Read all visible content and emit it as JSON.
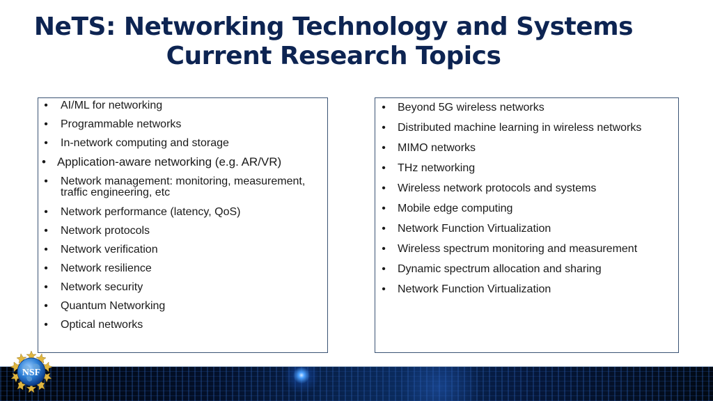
{
  "slide": {
    "title_line1": "NeTS: Networking Technology and Systems",
    "title_line2": "Current Research Topics"
  },
  "left_box": {
    "items": [
      "AI/ML for networking",
      "Programmable networks",
      "In-network computing and storage",
      "Application-aware networking (e.g.  AR/VR)",
      "Network management: monitoring, measurement, traffic engineering, etc",
      "Network performance (latency, QoS)",
      "Network protocols",
      "Network verification",
      "Network resilience",
      "Network security",
      "Quantum Networking",
      "Optical networks"
    ]
  },
  "right_box": {
    "items": [
      "Beyond 5G wireless networks",
      "Distributed machine learning in wireless networks",
      "MIMO networks",
      "THz networking",
      "Wireless network protocols and systems",
      "Mobile edge computing",
      "Network Function Virtualization",
      "Wireless spectrum monitoring and measurement",
      "Dynamic spectrum allocation and sharing",
      "Network Function Virtualization"
    ]
  },
  "bullet_char": "•",
  "logo": {
    "text": "NSF",
    "icon": "nsf-logo-icon"
  },
  "colors": {
    "title": "#0d2452",
    "box_border": "#3a5374",
    "text": "#1a1a1a"
  }
}
